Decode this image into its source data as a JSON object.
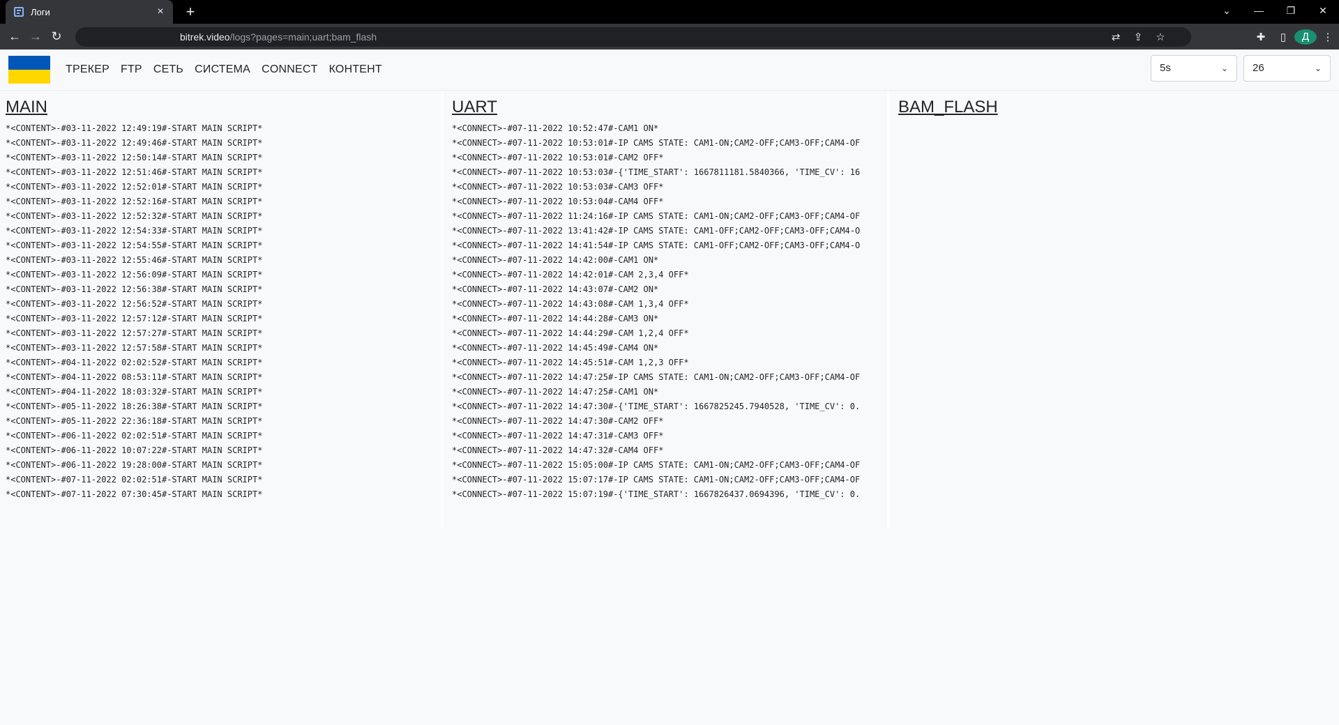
{
  "browser": {
    "tab_title": "Логи",
    "url_host": "bitrek.video",
    "url_path": "/logs?pages=main;uart;bam_flash",
    "avatar_letter": "Д"
  },
  "nav": {
    "items": [
      "ТРЕКЕР",
      "FTP",
      "СЕТЬ",
      "СИСТЕМА",
      "CONNECT",
      "КОНТЕНТ"
    ],
    "interval": "5s",
    "count": "26",
    "flag_colors": [
      "#0057b7",
      "#ffd700"
    ]
  },
  "columns": [
    {
      "title": "MAIN",
      "lines": [
        "*<CONTENT>-#03-11-2022 12:49:19#-START MAIN SCRIPT*",
        "*<CONTENT>-#03-11-2022 12:49:46#-START MAIN SCRIPT*",
        "*<CONTENT>-#03-11-2022 12:50:14#-START MAIN SCRIPT*",
        "*<CONTENT>-#03-11-2022 12:51:46#-START MAIN SCRIPT*",
        "*<CONTENT>-#03-11-2022 12:52:01#-START MAIN SCRIPT*",
        "*<CONTENT>-#03-11-2022 12:52:16#-START MAIN SCRIPT*",
        "*<CONTENT>-#03-11-2022 12:52:32#-START MAIN SCRIPT*",
        "*<CONTENT>-#03-11-2022 12:54:33#-START MAIN SCRIPT*",
        "*<CONTENT>-#03-11-2022 12:54:55#-START MAIN SCRIPT*",
        "*<CONTENT>-#03-11-2022 12:55:46#-START MAIN SCRIPT*",
        "*<CONTENT>-#03-11-2022 12:56:09#-START MAIN SCRIPT*",
        "*<CONTENT>-#03-11-2022 12:56:38#-START MAIN SCRIPT*",
        "*<CONTENT>-#03-11-2022 12:56:52#-START MAIN SCRIPT*",
        "*<CONTENT>-#03-11-2022 12:57:12#-START MAIN SCRIPT*",
        "*<CONTENT>-#03-11-2022 12:57:27#-START MAIN SCRIPT*",
        "*<CONTENT>-#03-11-2022 12:57:58#-START MAIN SCRIPT*",
        "*<CONTENT>-#04-11-2022 02:02:52#-START MAIN SCRIPT*",
        "*<CONTENT>-#04-11-2022 08:53:11#-START MAIN SCRIPT*",
        "*<CONTENT>-#04-11-2022 18:03:32#-START MAIN SCRIPT*",
        "*<CONTENT>-#05-11-2022 18:26:38#-START MAIN SCRIPT*",
        "*<CONTENT>-#05-11-2022 22:36:18#-START MAIN SCRIPT*",
        "*<CONTENT>-#06-11-2022 02:02:51#-START MAIN SCRIPT*",
        "*<CONTENT>-#06-11-2022 10:07:22#-START MAIN SCRIPT*",
        "*<CONTENT>-#06-11-2022 19:28:00#-START MAIN SCRIPT*",
        "*<CONTENT>-#07-11-2022 02:02:51#-START MAIN SCRIPT*",
        "*<CONTENT>-#07-11-2022 07:30:45#-START MAIN SCRIPT*"
      ]
    },
    {
      "title": "UART",
      "lines": [
        "*<CONNECT>-#07-11-2022 10:52:47#-CAM1 ON*",
        "*<CONNECT>-#07-11-2022 10:53:01#-IP CAMS STATE: CAM1-ON;CAM2-OFF;CAM3-OFF;CAM4-OF",
        "*<CONNECT>-#07-11-2022 10:53:01#-CAM2 OFF*",
        "*<CONNECT>-#07-11-2022 10:53:03#-{'TIME_START': 1667811181.5840366, 'TIME_CV': 16",
        "*<CONNECT>-#07-11-2022 10:53:03#-CAM3 OFF*",
        "*<CONNECT>-#07-11-2022 10:53:04#-CAM4 OFF*",
        "*<CONNECT>-#07-11-2022 11:24:16#-IP CAMS STATE: CAM1-ON;CAM2-OFF;CAM3-OFF;CAM4-OF",
        "*<CONNECT>-#07-11-2022 13:41:42#-IP CAMS STATE: CAM1-OFF;CAM2-OFF;CAM3-OFF;CAM4-O",
        "*<CONNECT>-#07-11-2022 14:41:54#-IP CAMS STATE: CAM1-OFF;CAM2-OFF;CAM3-OFF;CAM4-O",
        "*<CONNECT>-#07-11-2022 14:42:00#-CAM1 ON*",
        "*<CONNECT>-#07-11-2022 14:42:01#-CAM 2,3,4 OFF*",
        "*<CONNECT>-#07-11-2022 14:43:07#-CAM2 ON*",
        "*<CONNECT>-#07-11-2022 14:43:08#-CAM 1,3,4 OFF*",
        "*<CONNECT>-#07-11-2022 14:44:28#-CAM3 ON*",
        "*<CONNECT>-#07-11-2022 14:44:29#-CAM 1,2,4 OFF*",
        "*<CONNECT>-#07-11-2022 14:45:49#-CAM4 ON*",
        "*<CONNECT>-#07-11-2022 14:45:51#-CAM 1,2,3 OFF*",
        "*<CONNECT>-#07-11-2022 14:47:25#-IP CAMS STATE: CAM1-ON;CAM2-OFF;CAM3-OFF;CAM4-OF",
        "*<CONNECT>-#07-11-2022 14:47:25#-CAM1 ON*",
        "*<CONNECT>-#07-11-2022 14:47:30#-{'TIME_START': 1667825245.7940528, 'TIME_CV': 0.",
        "*<CONNECT>-#07-11-2022 14:47:30#-CAM2 OFF*",
        "*<CONNECT>-#07-11-2022 14:47:31#-CAM3 OFF*",
        "*<CONNECT>-#07-11-2022 14:47:32#-CAM4 OFF*",
        "*<CONNECT>-#07-11-2022 15:05:00#-IP CAMS STATE: CAM1-ON;CAM2-OFF;CAM3-OFF;CAM4-OF",
        "*<CONNECT>-#07-11-2022 15:07:17#-IP CAMS STATE: CAM1-ON;CAM2-OFF;CAM3-OFF;CAM4-OF",
        "*<CONNECT>-#07-11-2022 15:07:19#-{'TIME_START': 1667826437.0694396, 'TIME_CV': 0."
      ]
    },
    {
      "title": "BAM_FLASH",
      "lines": []
    }
  ]
}
